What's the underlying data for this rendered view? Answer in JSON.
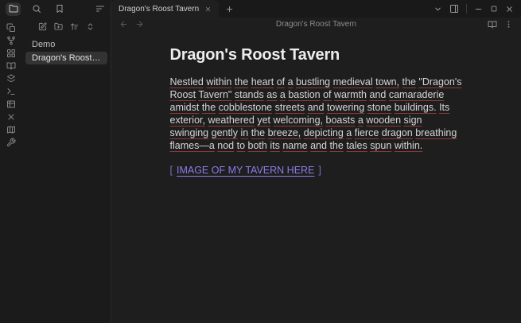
{
  "left": {
    "view_tabs": [
      {
        "icon": "folder",
        "active": true
      },
      {
        "icon": "search",
        "active": false
      },
      {
        "icon": "bookmark",
        "active": false
      }
    ],
    "collapse_icon": "list-collapse",
    "toolbar_icons": [
      "new-note",
      "new-folder",
      "sort-order",
      "collapse-all"
    ],
    "ribbon_icons": [
      "copy",
      "git-fork",
      "blocks",
      "book-open",
      "layers",
      "terminal",
      "table",
      "x",
      "map",
      "wrench"
    ],
    "files": [
      {
        "label": "Demo",
        "active": false
      },
      {
        "label": "Dragon's Roost Tavern",
        "active": true
      }
    ]
  },
  "tabbar": {
    "active_tab": "Dragon's Roost Tavern",
    "right_icons": [
      "chevron-down",
      "layout-sidebar-right"
    ],
    "window_controls": [
      "minimize",
      "maximize",
      "close"
    ]
  },
  "nav": {
    "breadcrumb": "Dragon's Roost Tavern",
    "left_icons": [
      "arrow-left",
      "arrow-right"
    ],
    "right_icons": [
      "reading-mode",
      "more-options"
    ]
  },
  "content": {
    "title": "Dragon's Roost Tavern",
    "paragraph": "Nestled within the heart of a bustling medieval town, the \"Dragon's Roost Tavern\" stands as a bastion of warmth and camaraderie amidst the cobblestone streets and towering stone buildings. Its exterior, weathered yet welcoming, boasts a wooden sign swinging gently in the breeze, depicting a fierce dragon breathing flames—a nod to both its name and the tales spun within.",
    "link": {
      "open_bracket": "[",
      "text": "IMAGE OF MY TAVERN HERE",
      "close_bracket": "]"
    }
  },
  "colors": {
    "bg_main": "#1e1e1e",
    "bg_side": "#1b1b1b",
    "accent_purple": "#8f7ae8",
    "spellcheck_red": "#8f3a36",
    "text": "#d6d6d6"
  }
}
